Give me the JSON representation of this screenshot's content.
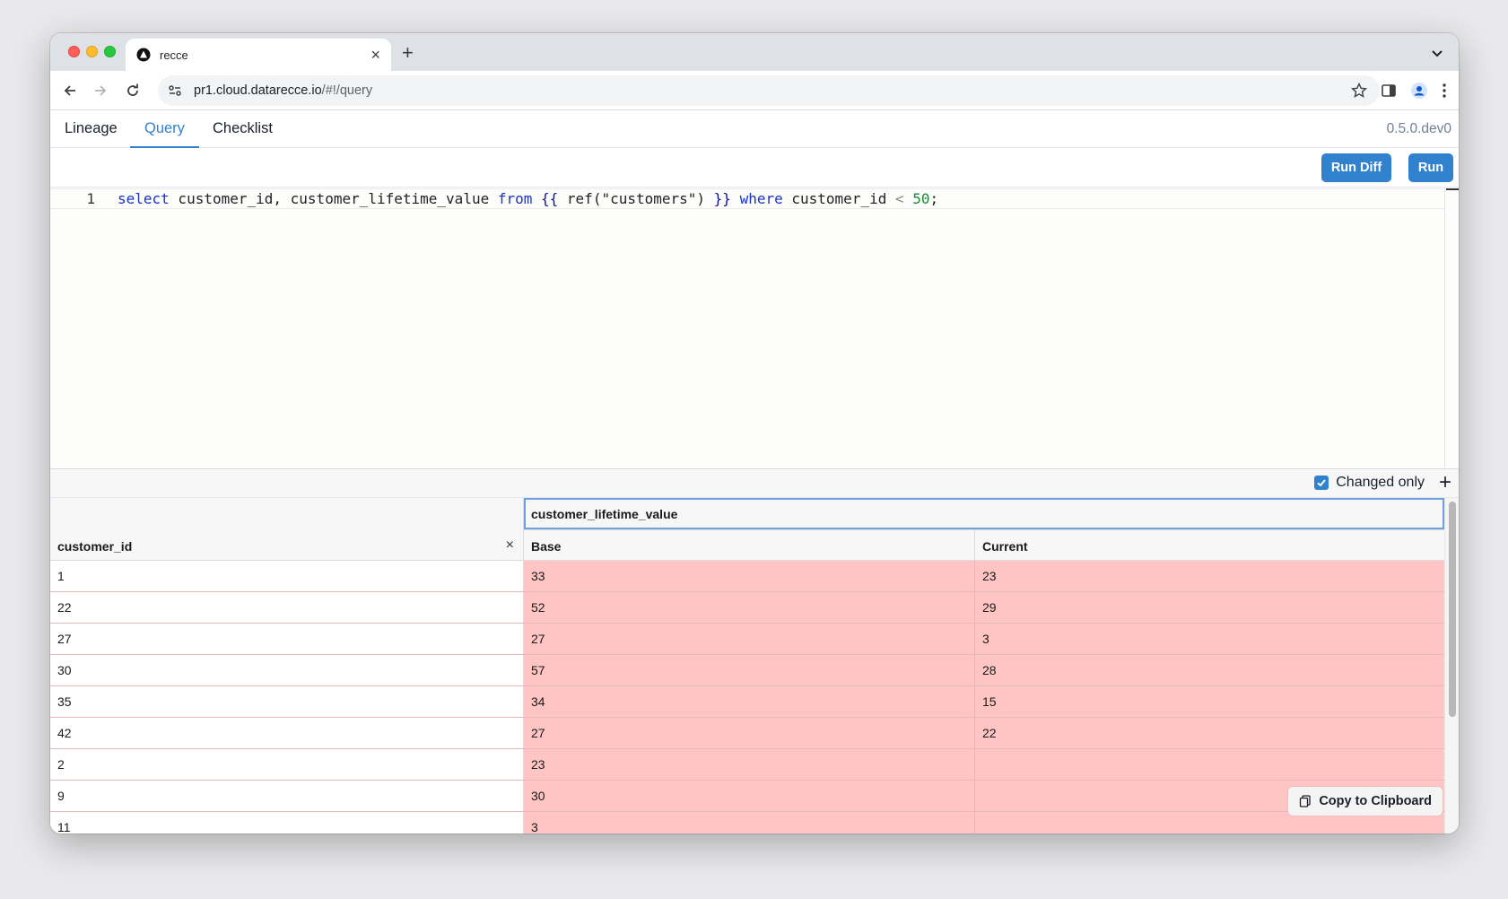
{
  "browser": {
    "tab_title": "recce",
    "url_host": "pr1.cloud.datarecce.io",
    "url_path": "/#!/query"
  },
  "app": {
    "tabs": [
      {
        "label": "Lineage"
      },
      {
        "label": "Query"
      },
      {
        "label": "Checklist"
      }
    ],
    "active_tab": "Query",
    "version": "0.5.0.dev0"
  },
  "query": {
    "run_diff_label": "Run Diff",
    "run_label": "Run",
    "line_number": "1",
    "sql": "select customer_id, customer_lifetime_value from {{ ref(\"customers\") }} where customer_id < 50;"
  },
  "results": {
    "changed_only_label": "Changed only",
    "changed_only_checked": true,
    "key_column": "customer_id",
    "group_column": "customer_lifetime_value",
    "base_label": "Base",
    "current_label": "Current",
    "rows": [
      {
        "id": "1",
        "base": "33",
        "current": "23"
      },
      {
        "id": "22",
        "base": "52",
        "current": "29"
      },
      {
        "id": "27",
        "base": "27",
        "current": "3"
      },
      {
        "id": "30",
        "base": "57",
        "current": "28"
      },
      {
        "id": "35",
        "base": "34",
        "current": "15"
      },
      {
        "id": "42",
        "base": "27",
        "current": "22"
      },
      {
        "id": "2",
        "base": "23",
        "current": ""
      },
      {
        "id": "9",
        "base": "30",
        "current": ""
      },
      {
        "id": "11",
        "base": "3",
        "current": ""
      }
    ],
    "copy_label": "Copy to Clipboard",
    "changed_color": "#ffc5c5",
    "accent_color": "#3182ce"
  }
}
